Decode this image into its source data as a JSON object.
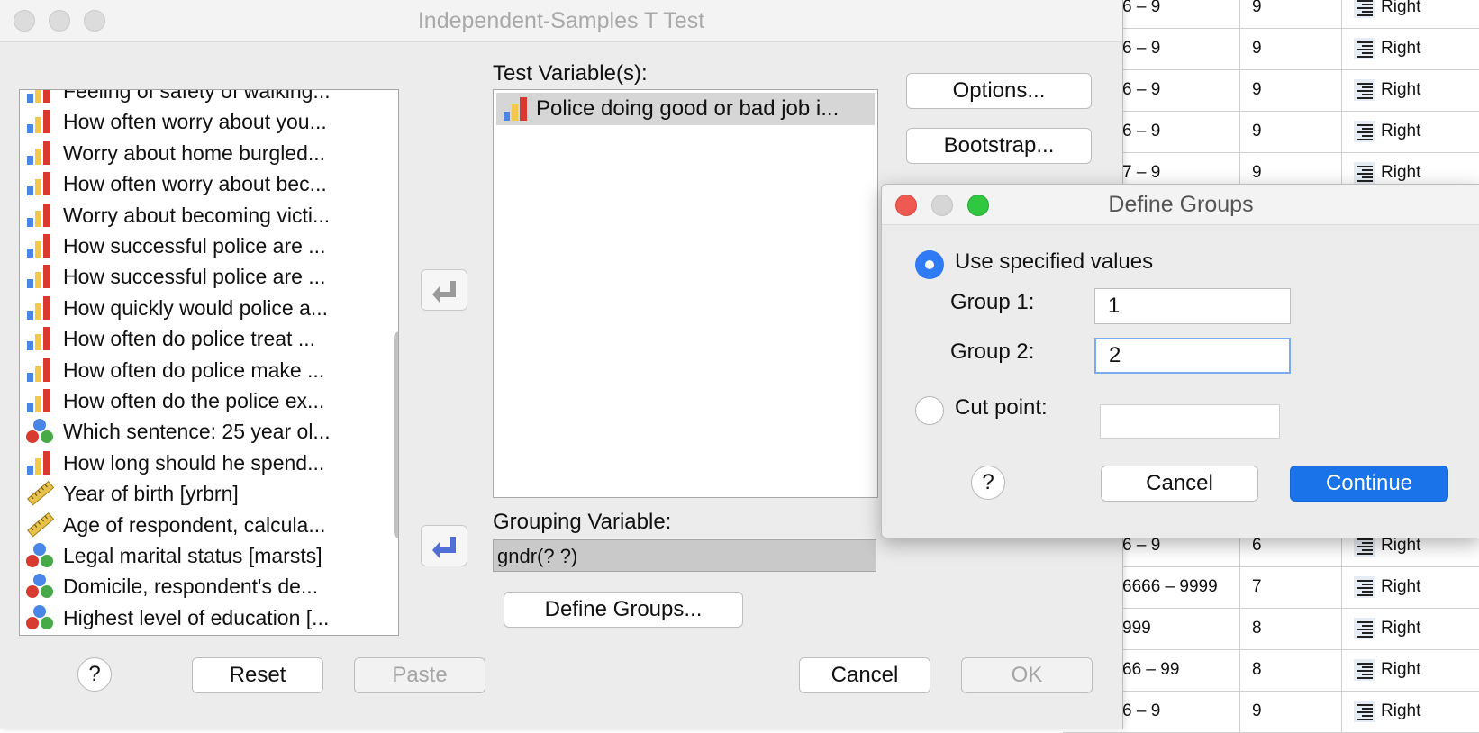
{
  "background_grid": {
    "rows": [
      {
        "values": "6 – 9",
        "columns": "9",
        "align": "Right"
      },
      {
        "values": "6 – 9",
        "columns": "9",
        "align": "Right"
      },
      {
        "values": "6 – 9",
        "columns": "9",
        "align": "Right"
      },
      {
        "values": "6 – 9",
        "columns": "9",
        "align": "Right"
      },
      {
        "values": "7 – 9",
        "columns": "9",
        "align": "Right"
      },
      {
        "values": "",
        "columns": "",
        "align": ""
      },
      {
        "values": "",
        "columns": "",
        "align": ""
      },
      {
        "values": "",
        "columns": "",
        "align": ""
      },
      {
        "values": "",
        "columns": "",
        "align": ""
      },
      {
        "values": "",
        "columns": "",
        "align": ""
      },
      {
        "values": "",
        "columns": "",
        "align": ""
      },
      {
        "values": "",
        "columns": "",
        "align": ""
      },
      {
        "values": "",
        "columns": "",
        "align": ""
      },
      {
        "values": "6 – 9",
        "columns": "6",
        "align": "Right"
      },
      {
        "values": "6666 – 9999",
        "columns": "7",
        "align": "Right"
      },
      {
        "values": "999",
        "columns": "8",
        "align": "Right"
      },
      {
        "values": "66 – 99",
        "columns": "8",
        "align": "Right"
      },
      {
        "values": "6 – 9",
        "columns": "9",
        "align": "Right"
      }
    ]
  },
  "main_dialog": {
    "title": "Independent-Samples T Test",
    "variables": [
      {
        "label": "Feeling of safety of walking...",
        "type": "ordinal"
      },
      {
        "label": "How often worry about you...",
        "type": "ordinal"
      },
      {
        "label": "Worry about home burgled...",
        "type": "ordinal"
      },
      {
        "label": "How often worry about bec...",
        "type": "ordinal"
      },
      {
        "label": "Worry about becoming victi...",
        "type": "ordinal"
      },
      {
        "label": "How successful police are ...",
        "type": "ordinal"
      },
      {
        "label": "How successful police are ...",
        "type": "ordinal"
      },
      {
        "label": "How quickly would police a...",
        "type": "ordinal"
      },
      {
        "label": "How often do police treat ...",
        "type": "ordinal"
      },
      {
        "label": "How often do police make ...",
        "type": "ordinal"
      },
      {
        "label": "How often do the police ex...",
        "type": "ordinal"
      },
      {
        "label": "Which sentence: 25 year ol...",
        "type": "nominal"
      },
      {
        "label": "How long should he spend...",
        "type": "ordinal"
      },
      {
        "label": "Year of birth [yrbrn]",
        "type": "scale"
      },
      {
        "label": "Age of respondent, calcula...",
        "type": "scale"
      },
      {
        "label": "Legal marital status [marsts]",
        "type": "nominal"
      },
      {
        "label": "Domicile, respondent's de...",
        "type": "nominal"
      },
      {
        "label": "Highest level of education [...",
        "type": "nominal"
      }
    ],
    "test_variables_label": "Test Variable(s):",
    "test_variables": [
      {
        "label": "Police doing good or bad job i...",
        "type": "ordinal"
      }
    ],
    "grouping_variable_label": "Grouping Variable:",
    "grouping_variable_value": "gndr(? ?)",
    "buttons": {
      "options": "Options...",
      "bootstrap": "Bootstrap...",
      "define_groups": "Define Groups...",
      "help": "?",
      "reset": "Reset",
      "paste": "Paste",
      "cancel": "Cancel",
      "ok": "OK"
    }
  },
  "define_groups_dialog": {
    "title": "Define Groups",
    "use_specified_values_label": "Use specified values",
    "group1_label": "Group 1:",
    "group1_value": "1",
    "group2_label": "Group 2:",
    "group2_value": "2",
    "cut_point_label": "Cut point:",
    "cut_point_value": "",
    "selected_option": "use_specified_values",
    "buttons": {
      "help": "?",
      "cancel": "Cancel",
      "continue": "Continue"
    },
    "colors": {
      "accent": "#1a73e8",
      "close": "#ee5a52",
      "zoom": "#2fc840"
    }
  }
}
